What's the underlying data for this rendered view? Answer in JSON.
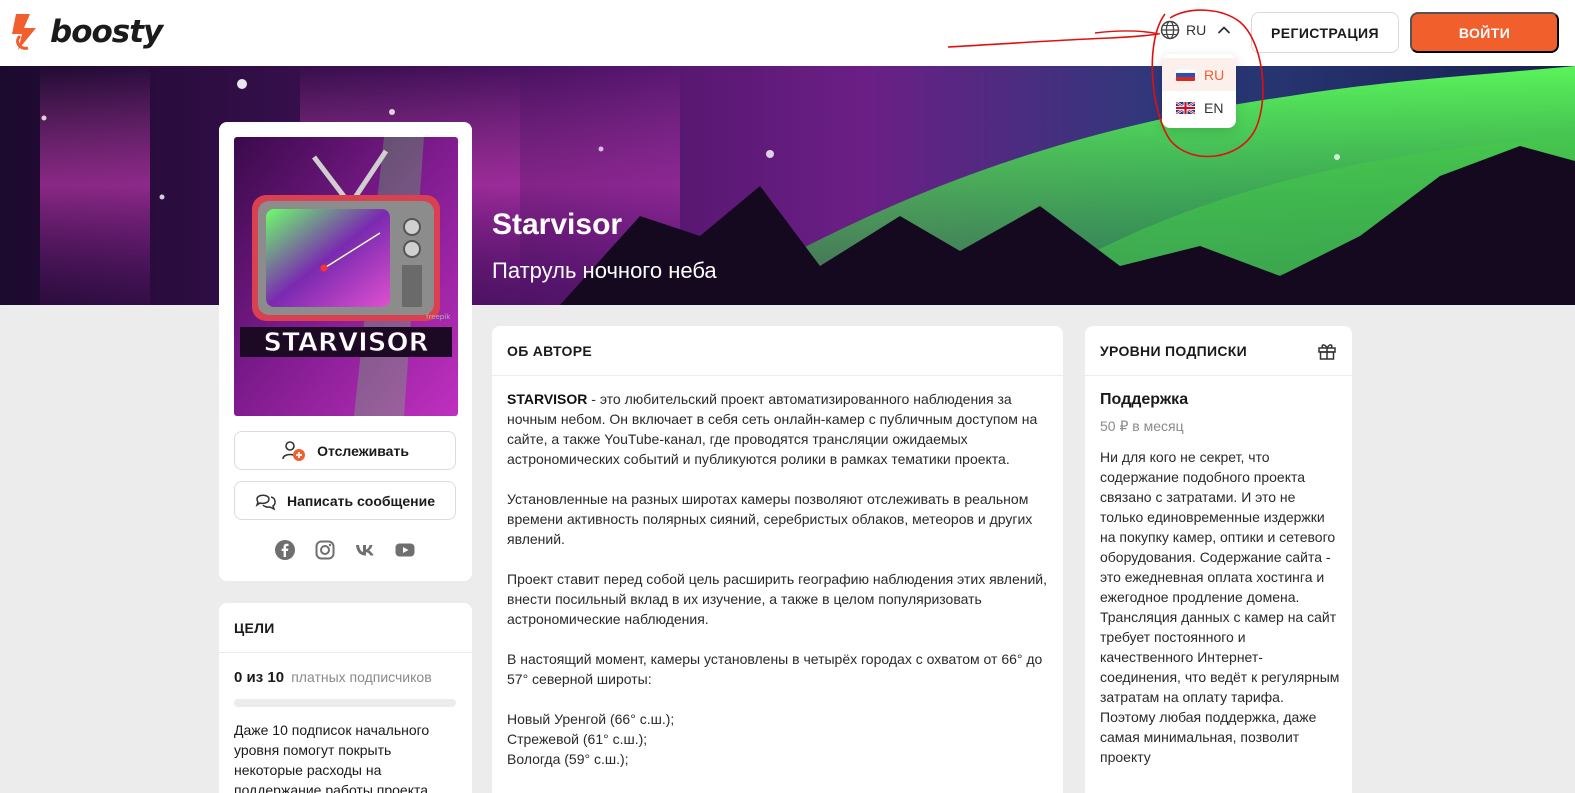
{
  "header": {
    "logo_text": "boosty",
    "language_current": "RU",
    "register_label": "РЕГИСТРАЦИЯ",
    "login_label": "ВОЙТИ"
  },
  "language_menu": {
    "options": [
      {
        "code": "RU",
        "flag": "flag-russia-icon",
        "active": true
      },
      {
        "code": "EN",
        "flag": "flag-uk-icon",
        "active": false
      }
    ]
  },
  "banner": {
    "title": "Starvisor",
    "subtitle": "Патруль ночного неба"
  },
  "profile": {
    "avatar_text": "STARVISOR",
    "avatar_credit": "freepik",
    "follow_label": "Отслеживать",
    "message_label": "Написать сообщение",
    "socials": [
      "facebook-icon",
      "instagram-icon",
      "vk-icon",
      "youtube-icon"
    ]
  },
  "goals": {
    "header": "ЦЕЛИ",
    "count": "0 из 10",
    "count_suffix": "платных подписчиков",
    "progress_fraction": 0.0,
    "description": "Даже 10 подписок начального уровня помогут покрыть некоторые расходы на поддержание работы проекта."
  },
  "about": {
    "header": "ОБ АВТОРЕ",
    "lead_bold": "STARVISOR",
    "lead_rest": " - это любительский проект автоматизированного наблюдения за ночным небом. Он включает в себя сеть онлайн-камер с публичным доступом на сайте, а также YouTube-канал, где проводятся трансляции ожидаемых астрономических событий и публикуются ролики в рамках тематики проекта.",
    "paragraph_2": "Установленные на разных широтах камеры позволяют отслеживать в реальном времени активность полярных сияний, серебристых облаков, метеоров и других явлений.",
    "paragraph_3": "Проект ставит перед собой цель расширить географию наблюдения этих явлений, внести посильный вклад в их изучение, а также в целом популяризовать астрономические наблюдения.",
    "paragraph_4": "В настоящий момент, камеры установлены в четырёх городах с охватом от 66° до 57° северной широты:",
    "cities": [
      "Новый Уренгой (66° с.ш.);",
      "Стрежевой (61° с.ш.);",
      "Вологда (59° с.ш.);"
    ]
  },
  "tiers": {
    "header": "УРОВНИ ПОДПИСКИ",
    "name": "Поддержка",
    "price": "50 ₽ в месяц",
    "description": "Ни для кого не секрет, что содержание подобного проекта связано с затратами. И это не только единовременные издержки на покупку камер, оптики и сетевого оборудования. Содержание сайта - это ежедневная оплата хостинга и ежегодное продление домена. Трансляция данных с камер на сайт требует постоянного и качественного Интернет-соединения, что ведёт к регулярным затратам на оплату тарифа. Поэтому любая поддержка, даже самая минимальная, позволит проекту"
  },
  "colors": {
    "accent": "#f15f2c",
    "annotation": "#e01010"
  }
}
